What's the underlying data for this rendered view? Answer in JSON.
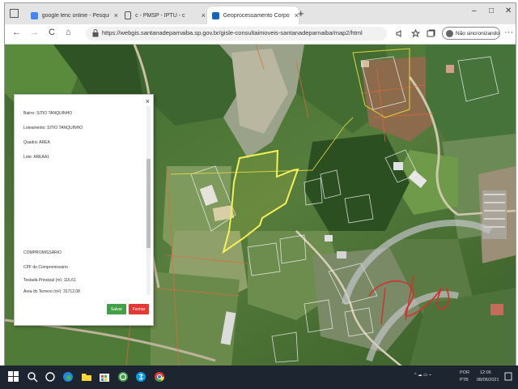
{
  "browser": {
    "tabs": [
      {
        "label": "google lenc online - Pesquisa G",
        "fav_color": "#4285f4"
      },
      {
        "label": "c - PMSP - IPTU - c",
        "fav_color": "#ffffff"
      },
      {
        "label": "Geoprocessamento Corporativ",
        "fav_color": "#1565c0"
      }
    ],
    "new_tab": "+",
    "tab_close": "×",
    "window_controls": [
      "–",
      "□",
      "✕"
    ],
    "nav": {
      "back": "←",
      "forward": "→",
      "reload": "C",
      "home": "⌂"
    },
    "url": "https://webgis.santanadeparnaiba.sp.gov.br/gisle-consultaimoveis-santanadeparnaiba/map2/html",
    "sync_label": "Não sincronizando",
    "menu": "···"
  },
  "panel": {
    "close": "×",
    "fields": [
      "Bairro: SITIO TANQUINHO",
      "Loteamento: SITIO TANQUINHO",
      "Quadra: AREA",
      "Lote: AREAA1",
      "COMPROMISSÁRIO",
      "CPF do Compromissário",
      "Testada Principal (m): 116,61",
      "Área do Terreno (m²): 31712,08"
    ],
    "save_label": "Salvar",
    "close_label": "Fechar"
  },
  "taskbar": {
    "tray_lang": "POR",
    "tray_layout": "PTB",
    "tray_time": "12:06",
    "tray_date": "08/06/2021"
  },
  "colors": {
    "selected_parcel": "#f3f05a",
    "parcel_outline": "#ffffff",
    "save_button": "#43a047",
    "close_button": "#e53935",
    "taskbar": "#1d2531"
  },
  "icons": [
    "search-icon",
    "task-view-icon",
    "edge-icon",
    "folder-icon",
    "store-icon",
    "whatsapp-icon",
    "skype-icon",
    "chrome-icon",
    "windows-icon"
  ]
}
